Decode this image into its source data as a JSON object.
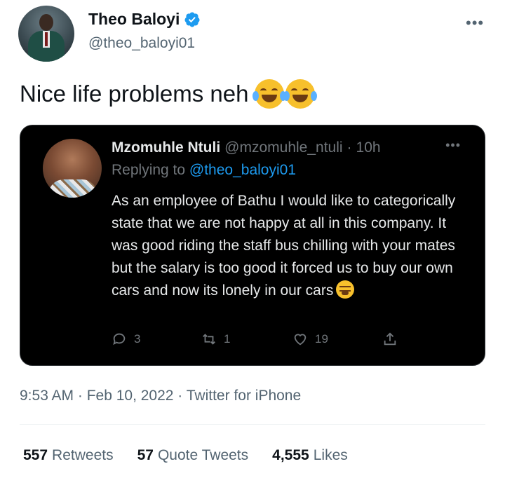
{
  "author": {
    "display_name": "Theo Baloyi",
    "handle": "@theo_baloyi01",
    "verified": true,
    "verified_icon": "verified-badge-icon",
    "accent": "#1d9bf0"
  },
  "tweet": {
    "text": "Nice life problems neh",
    "emojis": [
      "face-with-tears-of-joy",
      "face-with-tears-of-joy"
    ]
  },
  "quoted_tweet": {
    "display_name": "Mzomuhle Ntuli",
    "handle": "@mzomuhle_ntuli",
    "separator": "·",
    "time": "10h",
    "replying_to_label": "Replying to",
    "replying_to_handle": "@theo_baloyi01",
    "body": "As an employee of Bathu I would like to categorically state that we are not happy at all in this company. It was good riding the staff bus chilling with your mates but the salary is too good it forced us to buy our own cars and now its lonely in our cars",
    "trailing_emoji": "tired-face",
    "actions": {
      "reply_count": "3",
      "retweet_count": "1",
      "like_count": "19"
    }
  },
  "meta": {
    "line": "9:53 AM · Feb 10, 2022 · Twitter for iPhone"
  },
  "stats": {
    "retweets_count": "557",
    "retweets_label": "Retweets",
    "quote_tweets_count": "57",
    "quote_tweets_label": "Quote Tweets",
    "likes_count": "4,555",
    "likes_label": "Likes"
  }
}
